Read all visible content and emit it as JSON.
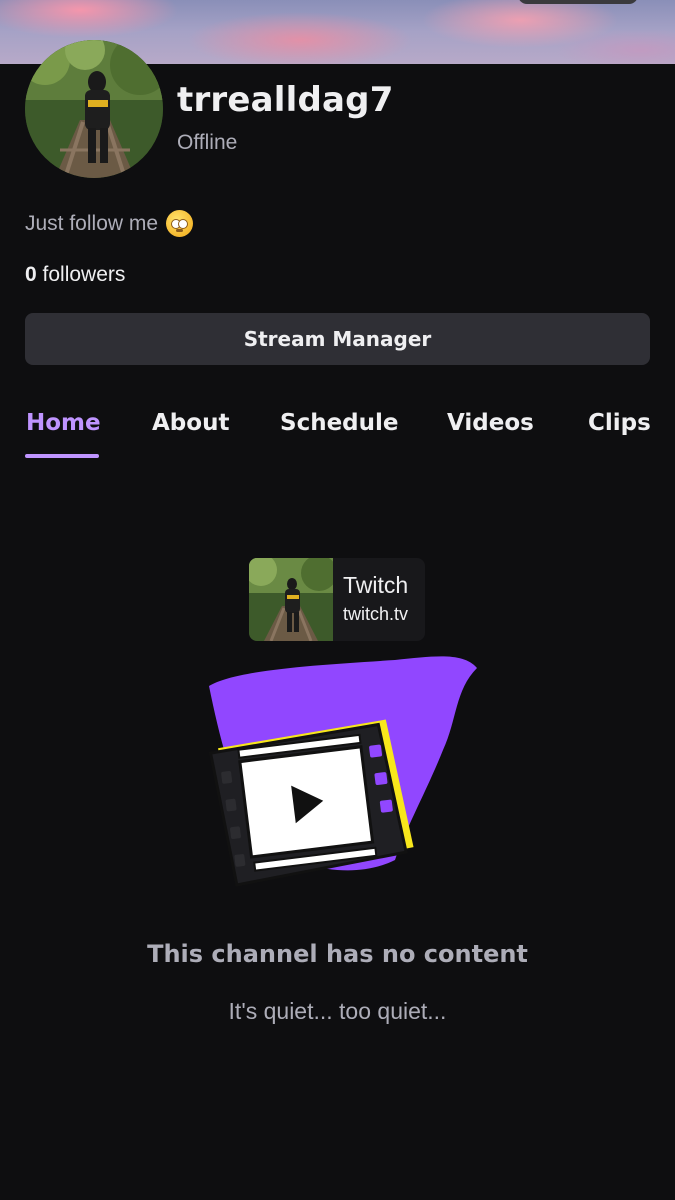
{
  "profile": {
    "username": "trrealldag7",
    "status": "Offline",
    "bio": "Just follow me",
    "bio_emoji": "face-with-rolling-eyes-emoji",
    "followers_count": "0",
    "followers_label": "followers"
  },
  "actions": {
    "stream_manager_label": "Stream Manager"
  },
  "tabs": [
    {
      "label": "Home",
      "active": true
    },
    {
      "label": "About",
      "active": false
    },
    {
      "label": "Schedule",
      "active": false
    },
    {
      "label": "Videos",
      "active": false
    },
    {
      "label": "Clips",
      "active": false
    }
  ],
  "link_card": {
    "title": "Twitch",
    "url": "twitch.tv"
  },
  "empty_state": {
    "title": "This channel has no content",
    "subtitle": "It's quiet... too quiet..."
  },
  "colors": {
    "background": "#0e0e10",
    "accent": "#bf94ff",
    "button": "#2f2f35",
    "muted_text": "#adadb8",
    "illustration_purple": "#9147ff",
    "illustration_yellow": "#f8e71c"
  }
}
